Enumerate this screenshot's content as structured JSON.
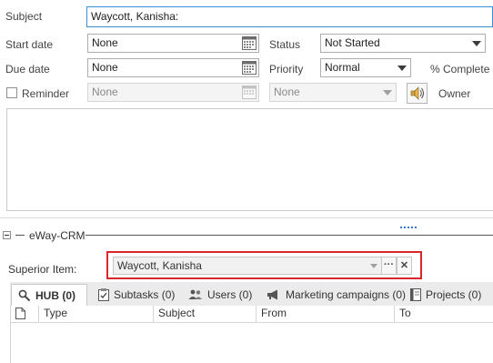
{
  "form": {
    "subject_label": "Subject",
    "subject_value": "Waycott, Kanisha:",
    "start_date_label": "Start date",
    "start_date_value": "None",
    "due_date_label": "Due date",
    "due_date_value": "None",
    "reminder_label": "Reminder",
    "reminder_date_value": "None",
    "reminder_time_value": "None",
    "status_label": "Status",
    "status_value": "Not Started",
    "priority_label": "Priority",
    "priority_value": "Normal",
    "percent_complete_label": "% Complete",
    "owner_label": "Owner"
  },
  "section": {
    "title": "eWay-CRM",
    "superior_item_label": "Superior Item:",
    "superior_item_value": "Waycott, Kanisha",
    "more_button": "···",
    "clear_button": "✕"
  },
  "tabs": [
    {
      "label": "HUB (0)",
      "icon": "hub-icon"
    },
    {
      "label": "Subtasks (0)",
      "icon": "subtasks-icon"
    },
    {
      "label": "Users (0)",
      "icon": "users-icon"
    },
    {
      "label": "Marketing campaigns (0)",
      "icon": "megaphone-icon"
    },
    {
      "label": "Projects (0)",
      "icon": "projects-icon"
    }
  ],
  "table": {
    "columns": [
      "Type",
      "Subject",
      "From",
      "To"
    ]
  },
  "colors": {
    "accent_border": "#3c8fd6",
    "highlight_red": "#d9262b",
    "splitter_dots": "#3a7bd5"
  }
}
